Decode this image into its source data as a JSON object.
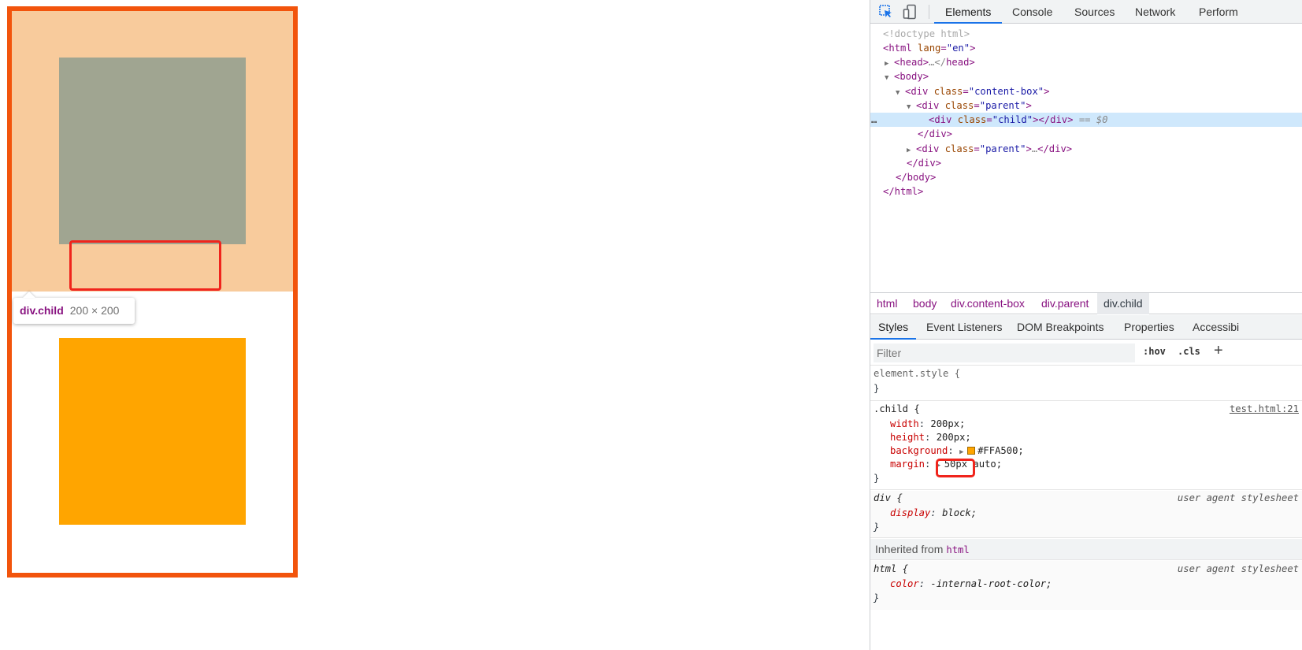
{
  "tooltip": {
    "name": "div.child",
    "size": "200 × 200"
  },
  "colors": {
    "content_border": "#F2540C",
    "margin_highlight": "#F8CB9C",
    "content_highlight": "#A0A591",
    "child_background": "#FFA500",
    "annotation_red": "#F0241C"
  },
  "devtools": {
    "tabs": [
      "Elements",
      "Console",
      "Sources",
      "Network",
      "Perform"
    ],
    "active_tab": "Elements",
    "tree": {
      "doctype": "<!doctype html>",
      "html_open_tag": "html",
      "html_attr": "lang",
      "html_val": "\"en\"",
      "head": "head",
      "head_collapsed": "…</",
      "head_close": "head",
      "body": "body",
      "div_tag": "div",
      "class_attr": "class",
      "content_box_val": "\"content-box\"",
      "parent_val": "\"parent\"",
      "child_val": "\"child\"",
      "close_div": "</div>",
      "eq": " == ",
      "dollar": "$0",
      "close_body": "</body>",
      "close_html": "</html>",
      "ellipsis": "…"
    },
    "breadcrumbs": [
      "html",
      "body",
      "div.content-box",
      "div.parent",
      "div.child"
    ],
    "subtabs": [
      "Styles",
      "Event Listeners",
      "DOM Breakpoints",
      "Properties",
      "Accessibi"
    ],
    "filter_placeholder": "Filter",
    "hov": ":hov",
    "cls": ".cls",
    "plus": "+",
    "styles": {
      "element_style": "element.style {",
      "close_brace": "}",
      "child_selector": ".child {",
      "source": "test.html:21",
      "width_prop": "width",
      "width_val": "200px;",
      "height_prop": "height",
      "height_val": "200px;",
      "bg_prop": "background",
      "bg_val": "#FFA500;",
      "margin_prop": "margin",
      "margin_val_1": "50px",
      "margin_val_2": "auto;",
      "div_selector": "div {",
      "ua_label": "user agent stylesheet",
      "display_prop": "display",
      "display_val": "block;",
      "inherited_label": "Inherited from",
      "inherited_tag": "html",
      "html_selector": "html {",
      "color_prop": "color",
      "color_val": "-internal-root-color;"
    }
  }
}
